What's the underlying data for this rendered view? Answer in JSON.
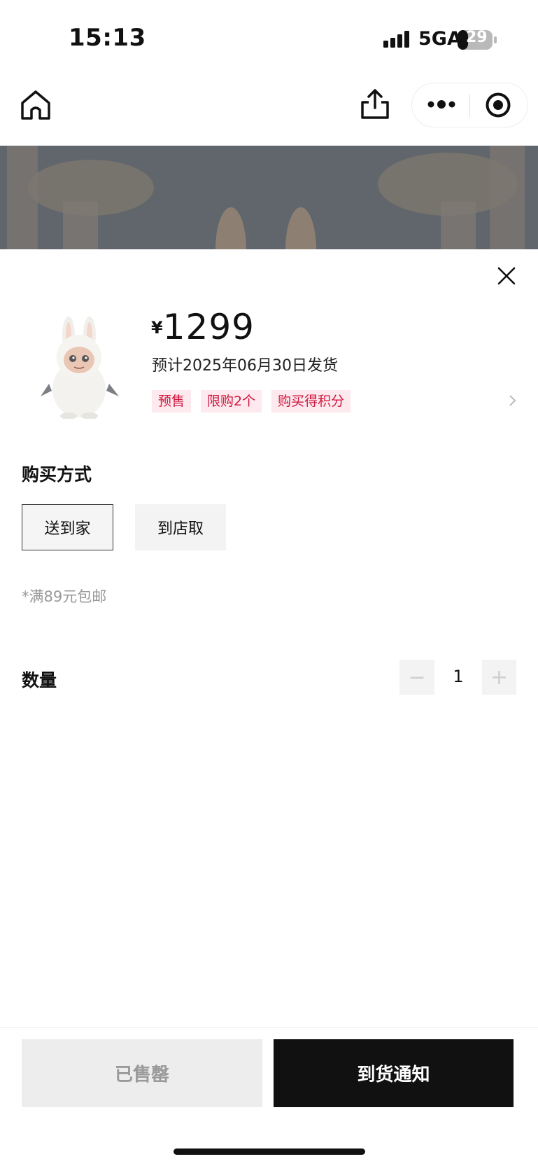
{
  "status_bar": {
    "time": "15:13",
    "network": "5GA",
    "battery": "29"
  },
  "nav": {
    "icons": [
      "home-icon",
      "share-icon",
      "more-icon",
      "target-icon"
    ]
  },
  "product": {
    "currency": "¥",
    "price": "1299",
    "ship_date": "预计2025年06月30日发货",
    "tags": [
      "预售",
      "限购2个",
      "购买得积分"
    ]
  },
  "purchase": {
    "title": "购买方式",
    "options": [
      "送到家",
      "到店取"
    ],
    "selected": "送到家",
    "shipping_note": "*满89元包邮"
  },
  "quantity": {
    "label": "数量",
    "minus": "−",
    "value": "1",
    "plus": "+"
  },
  "footer": {
    "sold_out": "已售罄",
    "notify": "到货通知"
  },
  "colors": {
    "tag_bg": "#fde9ee",
    "tag_text": "#d0173e",
    "primary_button": "#111111",
    "disabled_button": "#ededed"
  }
}
